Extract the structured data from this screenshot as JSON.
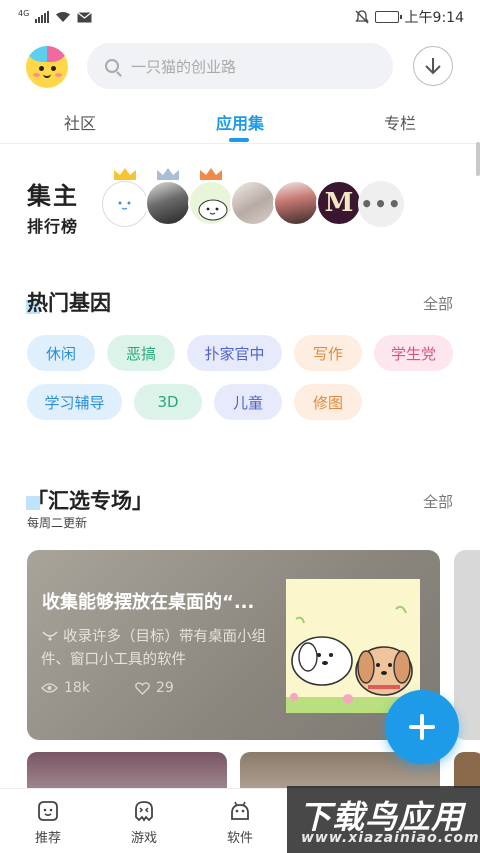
{
  "status_bar": {
    "network": "4G",
    "time": "上午9:14",
    "battery_level": 0.9,
    "icons": [
      "signal-icon",
      "wifi-icon",
      "mail-icon",
      "mute-icon",
      "battery-icon"
    ]
  },
  "header": {
    "search_placeholder": "一只猫的创业路",
    "avatar_icon": "smiley-avatar",
    "download_icon": "download-icon"
  },
  "tabs": [
    {
      "label": "社区",
      "active": false
    },
    {
      "label": "应用集",
      "active": true
    },
    {
      "label": "专栏",
      "active": false
    }
  ],
  "ranking": {
    "title_big": "集主",
    "title_small": "排行榜",
    "more_icon": "more-dots-icon"
  },
  "hot_genes": {
    "title": "热门基因",
    "all_label": "全部",
    "tags": [
      "休闲",
      "恶搞",
      "扑家官中",
      "写作",
      "学生党",
      "学习辅导",
      "3D",
      "儿童",
      "修图"
    ]
  },
  "collection": {
    "title": "「汇选专场」",
    "all_label": "全部",
    "subtitle": "每周二更新",
    "card": {
      "title": "收集能够摆放在桌面的“...",
      "description": "收录许多（目标）带有桌面小组件、窗口小工具的软件",
      "views": "18k",
      "likes": "29"
    }
  },
  "bottom_nav": [
    {
      "label": "推荐",
      "icon": "recommend-icon"
    },
    {
      "label": "游戏",
      "icon": "game-icon"
    },
    {
      "label": "软件",
      "icon": "android-icon"
    }
  ],
  "watermark": {
    "main": "下载鸟应用",
    "sub": "www.xiazainiao.com"
  },
  "colors": {
    "accent": "#1e9be8"
  }
}
